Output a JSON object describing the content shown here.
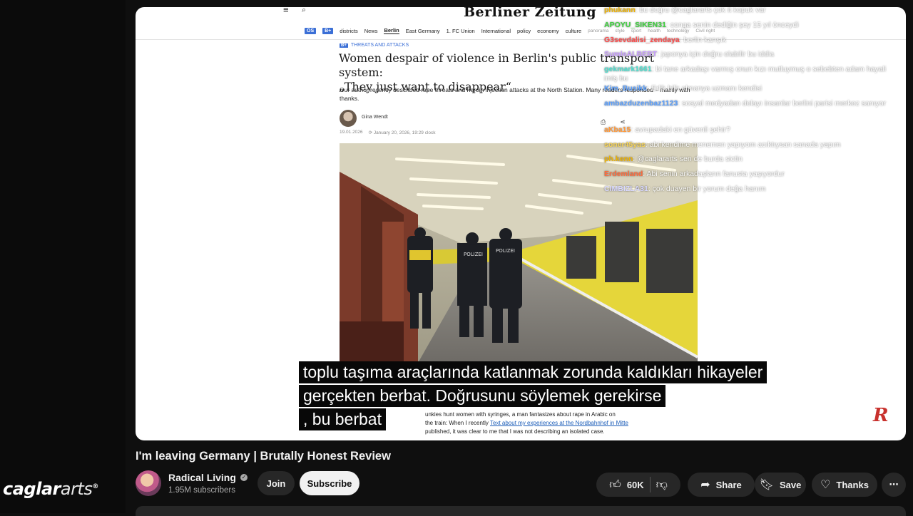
{
  "overlay_brand": {
    "part1": "caglar",
    "part2": "arts",
    "mark": "®"
  },
  "article": {
    "masthead": "Berliner Zeitung",
    "nav": [
      {
        "label": "OS",
        "type": "badge"
      },
      {
        "label": "B+",
        "type": "badge"
      },
      {
        "label": "districts"
      },
      {
        "label": "News"
      },
      {
        "label": "Berlin",
        "type": "active"
      },
      {
        "label": "East Germany"
      },
      {
        "label": "1. FC Union"
      },
      {
        "label": "International"
      },
      {
        "label": "policy"
      },
      {
        "label": "economy"
      },
      {
        "label": "culture"
      },
      {
        "label": "panorama",
        "type": "faded"
      },
      {
        "label": "style",
        "type": "faded"
      },
      {
        "label": "sport",
        "type": "faded"
      },
      {
        "label": "health",
        "type": "faded"
      },
      {
        "label": "technology",
        "type": "faded"
      },
      {
        "label": "Civil right",
        "type": "faded"
      }
    ],
    "kicker_badge": "B+",
    "kicker": "THREATS AND ATTACKS",
    "headline_1": "Women despair of violence in Berlin's public transport system:",
    "headline_2": "„They just want to disappear“",
    "teaser": "Our author recently described rape threats and heroin injection attacks at the North Station. Many readers responded – mainly with thanks.",
    "author": "Gina Wendt",
    "date_1": "19.01.2026",
    "date_2": "January 20, 2026, 19:29 clock",
    "body_line_1": "unkies hunt women with syringes, a man fantasizes about rape in Arabic on",
    "body_line_2a": "the train: When I recently ",
    "body_link": "Text about my experiences at the Nordbahnhof in Mitte",
    "body_line_2b": " published, it was clear to me that I was not describing an isolated case.",
    "photo_sign_1": "POLIZEI",
    "photo_sign_2": "POLIZEI"
  },
  "chat": [
    {
      "user": "phukann",
      "text": ": bu doğru @caglararts çok it kopuk var",
      "color": "#f0b400"
    },
    {
      "user": "APOYU_SIKEN31",
      "text": ": conga senin dediğin şey 15 yıl önceydi",
      "color": "#3fd23f"
    },
    {
      "user": "G3sevdalisi_zendaya",
      "text": ": berlin karışık",
      "color": "#ff4a4a"
    },
    {
      "user": "SumleALBERT",
      "text": ": japonya için doğru olabilir bu iddia",
      "color": "#c9a0ff"
    },
    {
      "user": "gekmark1661",
      "text": ": bi tane arkadaşı varmış onun kızı mutluymuş o sebebten adam hayali imiş bu",
      "color": "#4de0d0"
    },
    {
      "user": "Kim_Busikk",
      "text": ": Erlik bilir almanya uzmanı kendisi",
      "color": "#5aa0ff"
    },
    {
      "user": "ambazduzenbaz1123",
      "text": ": sosyal medyadan dolayı insanlar berlini parisi merkez sanıyor",
      "color": "#5aa0ff"
    },
    {
      "user": "aKba15",
      "text": ": avrupadaki en güvenli şehir?",
      "color": "#ff9a3c"
    },
    {
      "user": "soner45yas",
      "text": ": abi kendime menemen yapıyom acıktıysan sanada yapım",
      "color": "#f5d35a"
    },
    {
      "user": "ph.kenn",
      "text": ": @caglararts sen de burda sictin",
      "color": "#f0b400"
    },
    {
      "user": "Erdemland",
      "text": ": Abi senin arkadaşların fanusta yaşıyordur",
      "color": "#ff6a3c"
    },
    {
      "user": "CIMBIZLA31",
      "text": ": çok duayen bir yorum değa hanım",
      "color": "#d8d8ff"
    }
  ],
  "subtitles": {
    "line_1": "toplu taşıma araçlarında katlanmak zorunda kaldıkları hikayeler",
    "line_2": "gerçekten berbat.  Doğrusunu söylemek gerekirse",
    "line_3": ", bu berbat"
  },
  "video": {
    "title": "I'm leaving Germany | Brutally Honest Review",
    "channel": "Radical Living",
    "subscribers": "1.95M subscribers",
    "join": "Join",
    "subscribe": "Subscribe",
    "likes": "60K",
    "share": "Share",
    "save": "Save",
    "thanks": "Thanks",
    "more": "⋯"
  }
}
